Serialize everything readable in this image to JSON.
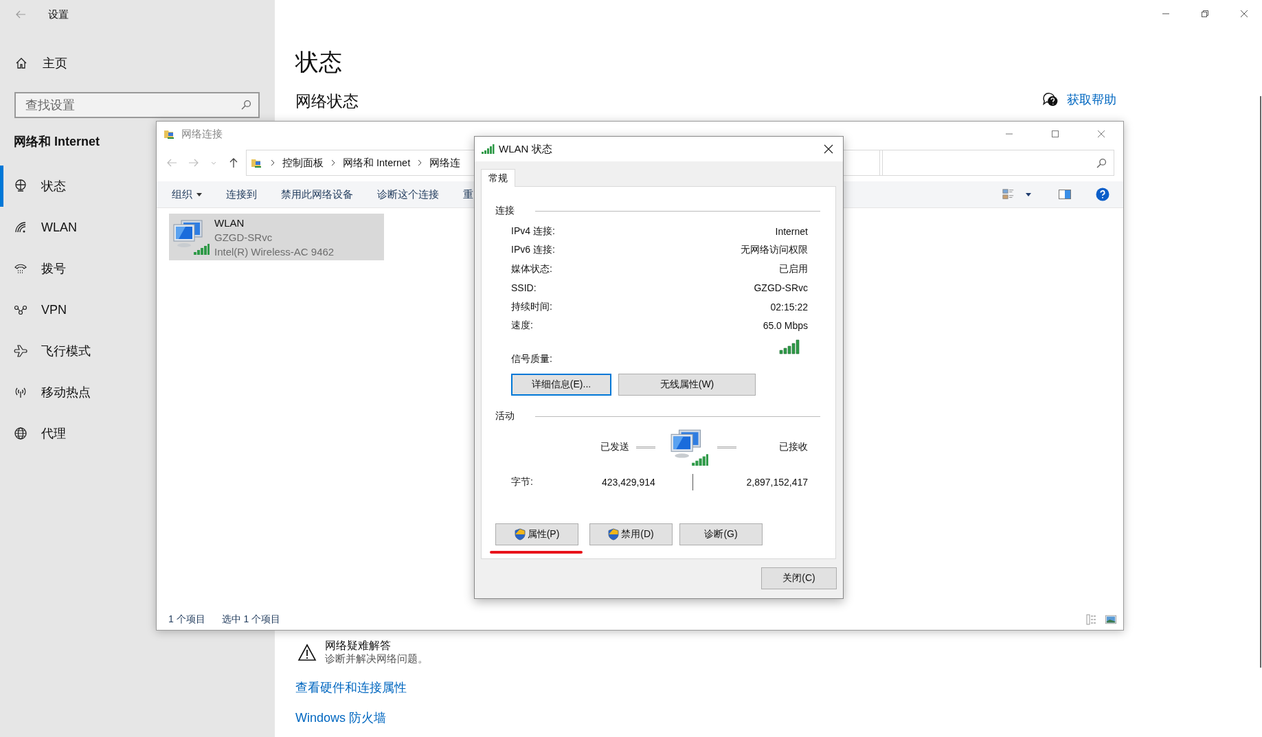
{
  "settings": {
    "title": "设置",
    "home": "主页",
    "search": {
      "placeholder": "查找设置"
    },
    "section": "网络和 Internet",
    "nav": [
      {
        "label": "状态",
        "selected": true
      },
      {
        "label": "WLAN",
        "selected": false
      },
      {
        "label": "拨号",
        "selected": false
      },
      {
        "label": "VPN",
        "selected": false
      },
      {
        "label": "飞行模式",
        "selected": false
      },
      {
        "label": "移动热点",
        "selected": false
      },
      {
        "label": "代理",
        "selected": false
      }
    ]
  },
  "page": {
    "title": "状态",
    "subtitle": "网络状态",
    "help_link": "获取帮助",
    "troubleshoot": {
      "title": "网络疑难解答",
      "description": "诊断并解决网络问题。"
    },
    "links": [
      "查看硬件和连接属性",
      "Windows 防火墙"
    ]
  },
  "explorer": {
    "title": "网络连接",
    "breadcrumb": [
      "控制面板",
      "网络和 Internet",
      "网络连"
    ],
    "toolbar": [
      {
        "label": "组织",
        "dropdown": true
      },
      {
        "label": "连接到",
        "dropdown": false
      },
      {
        "label": "禁用此网络设备",
        "dropdown": false
      },
      {
        "label": "诊断这个连接",
        "dropdown": false
      },
      {
        "label": "重",
        "dropdown": false
      }
    ],
    "items": [
      {
        "name": "WLAN",
        "network": "GZGD-SRvc",
        "adapter": "Intel(R) Wireless-AC 9462",
        "selected": true
      }
    ],
    "status": [
      "1 个项目",
      "选中 1 个项目"
    ]
  },
  "dialog": {
    "title": "WLAN 状态",
    "tabs": [
      {
        "label": "常规",
        "selected": true
      }
    ],
    "connection": {
      "heading": "连接",
      "rows": [
        {
          "label": "IPv4 连接:",
          "value": "Internet"
        },
        {
          "label": "IPv6 连接:",
          "value": "无网络访问权限"
        },
        {
          "label": "媒体状态:",
          "value": "已启用"
        },
        {
          "label": "SSID:",
          "value": "GZGD-SRvc"
        },
        {
          "label": "持续时间:",
          "value": "02:15:22"
        },
        {
          "label": "速度:",
          "value": "65.0 Mbps"
        }
      ],
      "signal_label": "信号质量:"
    },
    "buttons": [
      {
        "label": "详细信息(E)...",
        "focused": true
      },
      {
        "label": "无线属性(W)",
        "focused": false
      }
    ],
    "activity": {
      "heading": "活动",
      "sent_label": "已发送",
      "received_label": "已接收",
      "bytes_label": "字节:",
      "bytes_sent": "423,429,914",
      "bytes_received": "2,897,152,417"
    },
    "bottom_buttons": [
      {
        "label": "属性(P)",
        "shield": true,
        "underlined": true
      },
      {
        "label": "禁用(D)",
        "shield": true,
        "underlined": false
      },
      {
        "label": "诊断(G)",
        "shield": false,
        "underlined": false
      }
    ],
    "close": "关闭(C)"
  }
}
